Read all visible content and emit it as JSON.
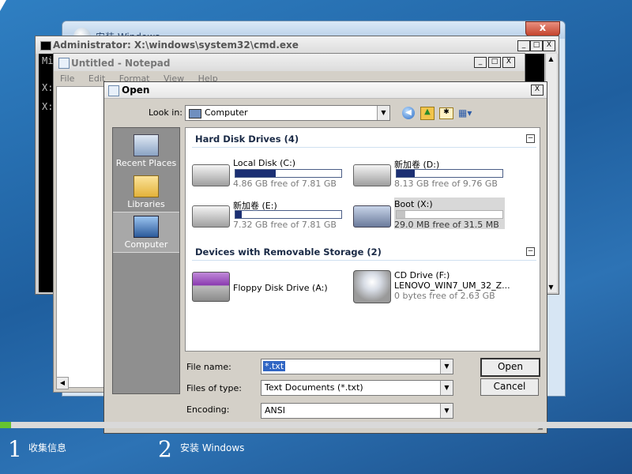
{
  "setup_window": {
    "title": "安装 Windows",
    "close_label": "x"
  },
  "cmd_window": {
    "title": "Administrator: X:\\windows\\system32\\cmd.exe",
    "lines": [
      "Mi",
      "X:",
      "X:"
    ],
    "controls": {
      "min": "_",
      "max": "□",
      "close": "X"
    }
  },
  "notepad": {
    "title": "Untitled - Notepad",
    "menu": [
      "File",
      "Edit",
      "Format",
      "View",
      "Help"
    ]
  },
  "open_dialog": {
    "title": "Open",
    "look_in_label": "Look in:",
    "look_in_value": "Computer",
    "toolbar_icons": [
      "back-icon",
      "up-folder-icon",
      "new-folder-icon",
      "views-icon"
    ],
    "places": [
      {
        "label": "Recent Places",
        "icon": "recent-places-icon"
      },
      {
        "label": "Libraries",
        "icon": "libraries-icon"
      },
      {
        "label": "Computer",
        "icon": "computer-icon"
      }
    ],
    "groups": [
      {
        "title": "Hard Disk Drives (4)"
      },
      {
        "title": "Devices with Removable Storage (2)"
      }
    ],
    "drives": [
      {
        "name": "Local Disk (C:)",
        "free": "4.86 GB free of 7.81 GB",
        "used_fraction": 0.38
      },
      {
        "name": "新加卷 (D:)",
        "free": "8.13 GB free of 9.76 GB",
        "used_fraction": 0.17
      },
      {
        "name": "新加卷 (E:)",
        "free": "7.32 GB free of 7.81 GB",
        "used_fraction": 0.06
      },
      {
        "name": "Boot (X:)",
        "free": "29.0 MB free of 31.5 MB",
        "used_fraction": 0.08
      }
    ],
    "removable": [
      {
        "name": "Floppy Disk Drive (A:)"
      },
      {
        "name": "CD Drive (F:)",
        "label": "LENOVO_WIN7_UM_32_Z...",
        "free": "0 bytes free of 2.63 GB"
      }
    ],
    "file_name_label": "File name:",
    "file_name_value": "*.txt",
    "file_type_label": "Files of type:",
    "file_type_value": "Text Documents (*.txt)",
    "encoding_label": "Encoding:",
    "encoding_value": "ANSI",
    "open_button": "Open",
    "cancel_button": "Cancel",
    "collapse_symbol": "−",
    "close_symbol": "X"
  },
  "setup_steps": [
    {
      "num": "1",
      "label": "收集信息"
    },
    {
      "num": "2",
      "label": "安装 Windows"
    }
  ],
  "colors": {
    "drive_bar": "#1b2f73",
    "progress": "#66c330",
    "desktop": "#2d73b5"
  }
}
